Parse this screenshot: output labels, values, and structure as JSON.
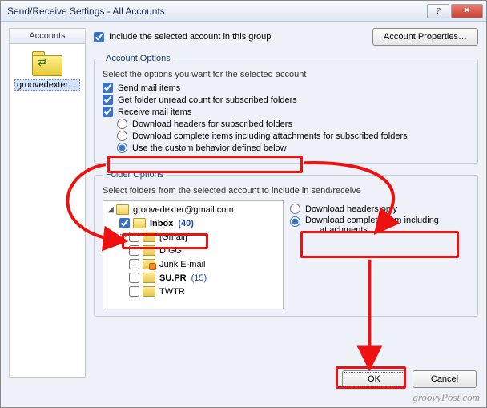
{
  "window": {
    "title": "Send/Receive Settings - All Accounts",
    "help_glyph": "?",
    "close_glyph": "✕"
  },
  "accounts_panel": {
    "header": "Accounts",
    "items": [
      {
        "label": "groovedexter@…"
      }
    ]
  },
  "top": {
    "include_label": "Include the selected account in this group",
    "properties_button": "Account Properties…"
  },
  "account_options": {
    "legend": "Account Options",
    "desc": "Select the options you want for the selected account",
    "send_mail": "Send mail items",
    "get_unread": "Get folder unread count for subscribed folders",
    "receive_mail": "Receive mail items",
    "dl_headers": "Download headers for subscribed folders",
    "dl_complete": "Download complete items including attachments for subscribed folders",
    "custom": "Use the custom behavior defined below"
  },
  "folder_options": {
    "legend": "Folder Options",
    "desc": "Select folders from the selected account to include in send/receive",
    "tree": {
      "root": "groovedexter@gmail.com",
      "nodes": [
        {
          "label": "Inbox",
          "count": "(40)",
          "checked": true,
          "bold": true,
          "icon": "env"
        },
        {
          "label": "[Gmail]",
          "expandable": true
        },
        {
          "label": "DIGG"
        },
        {
          "label": "Junk E-mail",
          "icon": "rss"
        },
        {
          "label": "SU.PR",
          "count": "(15)",
          "bold": true
        },
        {
          "label": "TWTR"
        }
      ]
    },
    "right": {
      "headers_only": "Download headers only",
      "complete_l1": "Download complete item including",
      "complete_l2": "attachments"
    }
  },
  "buttons": {
    "ok": "OK",
    "cancel": "Cancel"
  },
  "watermark": "groovyPost.com"
}
